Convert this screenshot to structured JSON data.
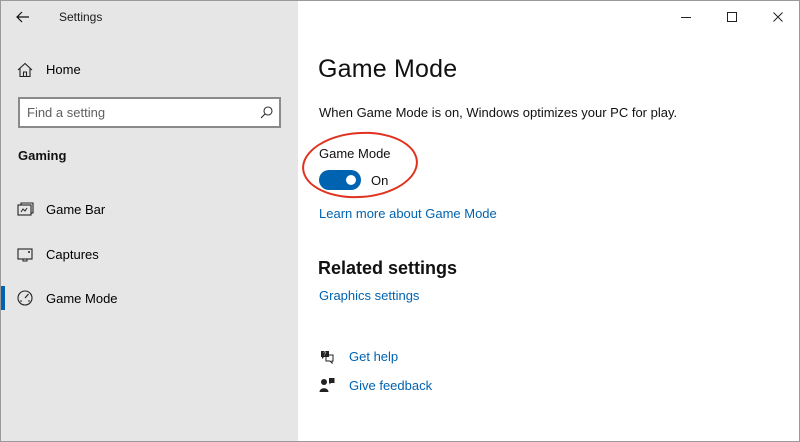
{
  "window": {
    "title": "Settings",
    "controls": [
      "minimize-icon",
      "maximize-icon",
      "close-icon"
    ]
  },
  "sidebar": {
    "home_label": "Home",
    "search_placeholder": "Find a setting",
    "section_title": "Gaming",
    "items": [
      {
        "label": "Game Bar",
        "icon": "game-bar-icon",
        "selected": false
      },
      {
        "label": "Captures",
        "icon": "captures-icon",
        "selected": false
      },
      {
        "label": "Game Mode",
        "icon": "game-mode-icon",
        "selected": true
      }
    ]
  },
  "main": {
    "title": "Game Mode",
    "description": "When Game Mode is on, Windows optimizes your PC for play.",
    "toggle": {
      "label": "Game Mode",
      "state_text": "On",
      "on": true
    },
    "learn_more": "Learn more about Game Mode",
    "related_title": "Related settings",
    "related_links": [
      "Graphics settings"
    ],
    "help": {
      "get_help": "Get help",
      "give_feedback": "Give feedback"
    }
  },
  "colors": {
    "accent": "#0063b1",
    "sidebar_bg": "#e6e6e6",
    "annotation": "#e0321e"
  }
}
